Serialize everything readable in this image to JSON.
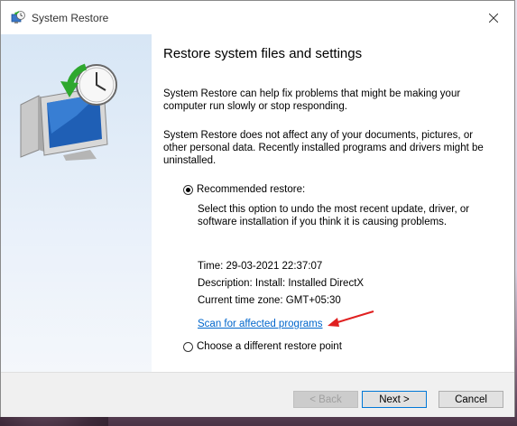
{
  "window": {
    "title": "System Restore",
    "close_icon": "close-icon",
    "title_icon": "system-restore-icon"
  },
  "side_panel": {
    "art_icon": "computer-restore-clock-icon"
  },
  "main": {
    "heading": "Restore system files and settings",
    "para1": "System Restore can help fix problems that might be making your computer run slowly or stop responding.",
    "para2": "System Restore does not affect any of your documents, pictures, or other personal data. Recently installed programs and drivers might be uninstalled.",
    "recommended_label": "Recommended restore:",
    "recommended_selected": true,
    "recommended_desc": "Select this option to undo the most recent update, driver, or software installation if you think it is causing problems.",
    "time": "Time: 29-03-2021 22:37:07",
    "description": "Description: Install: Installed DirectX",
    "timezone": "Current time zone: GMT+05:30",
    "scan_link": "Scan for affected programs",
    "different_label": "Choose a different restore point",
    "different_selected": false,
    "link_color": "#0066cc",
    "annotation_arrow_color": "#e02020"
  },
  "footer": {
    "back_label": "< Back",
    "back_enabled": false,
    "next_label": "Next >",
    "cancel_label": "Cancel"
  }
}
